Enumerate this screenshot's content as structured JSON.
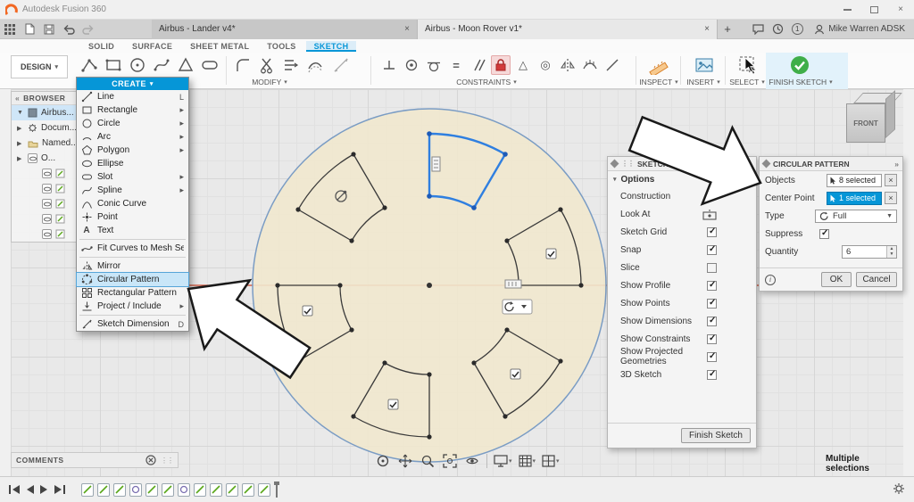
{
  "title_bar": {
    "app_title": "Autodesk Fusion 360"
  },
  "tab_bar": {
    "tabs": [
      {
        "label": "Airbus - Lander v4*"
      },
      {
        "label": "Airbus - Moon Rover v1*"
      }
    ],
    "notification_count": "1",
    "user_name": "Mike Warren ADSK"
  },
  "ribbon": {
    "env_tabs": [
      {
        "label": "SOLID"
      },
      {
        "label": "SURFACE"
      },
      {
        "label": "SHEET METAL"
      },
      {
        "label": "TOOLS"
      },
      {
        "label": "SKETCH"
      }
    ],
    "design_label": "DESIGN",
    "group_labels": {
      "create": "CREATE",
      "modify": "MODIFY",
      "constraints": "CONSTRAINTS",
      "inspect": "INSPECT",
      "insert": "INSERT",
      "select": "SELECT",
      "finish": "FINISH SKETCH"
    }
  },
  "browser": {
    "header": "BROWSER",
    "items": [
      {
        "label": "Airbus..."
      },
      {
        "label": "Docum..."
      },
      {
        "label": "Named..."
      },
      {
        "label": "O..."
      }
    ]
  },
  "create_menu": {
    "header": "CREATE",
    "items": [
      {
        "label": "Line",
        "shortcut": "L"
      },
      {
        "label": "Rectangle"
      },
      {
        "label": "Circle"
      },
      {
        "label": "Arc"
      },
      {
        "label": "Polygon"
      },
      {
        "label": "Ellipse"
      },
      {
        "label": "Slot"
      },
      {
        "label": "Spline"
      },
      {
        "label": "Conic Curve"
      },
      {
        "label": "Point"
      },
      {
        "label": "Text"
      },
      {
        "label": "Fit Curves to Mesh Section"
      },
      {
        "label": "Mirror"
      },
      {
        "label": "Circular Pattern",
        "highlighted": true
      },
      {
        "label": "Rectangular Pattern"
      },
      {
        "label": "Project / Include"
      },
      {
        "label": "Sketch Dimension",
        "shortcut": "D"
      }
    ]
  },
  "sketch_palette": {
    "header": "SKETCH PALETTE",
    "section": "Options",
    "rows": [
      {
        "label": "Construction",
        "type": "icon"
      },
      {
        "label": "Look At",
        "type": "icon"
      },
      {
        "label": "Sketch Grid",
        "type": "checkbox",
        "checked": true
      },
      {
        "label": "Snap",
        "type": "checkbox",
        "checked": true
      },
      {
        "label": "Slice",
        "type": "checkbox",
        "checked": false
      },
      {
        "label": "Show Profile",
        "type": "checkbox",
        "checked": true
      },
      {
        "label": "Show Points",
        "type": "checkbox",
        "checked": true
      },
      {
        "label": "Show Dimensions",
        "type": "checkbox",
        "checked": true
      },
      {
        "label": "Show Constraints",
        "type": "checkbox",
        "checked": true
      },
      {
        "label": "Show Projected Geometries",
        "type": "checkbox",
        "checked": true
      },
      {
        "label": "3D Sketch",
        "type": "checkbox",
        "checked": true
      }
    ],
    "finish_button": "Finish Sketch"
  },
  "circular_pattern": {
    "header": "CIRCULAR PATTERN",
    "objects_label": "Objects",
    "objects_value": "8 selected",
    "center_label": "Center Point",
    "center_value": "1 selected",
    "type_label": "Type",
    "type_value": "Full",
    "suppress_label": "Suppress",
    "suppress_checked": true,
    "quantity_label": "Quantity",
    "quantity_value": "6",
    "ok": "OK",
    "cancel": "Cancel"
  },
  "viewcube": {
    "front_label": "FRONT"
  },
  "status": {
    "selection": "Multiple selections"
  },
  "comments": {
    "label": "COMMENTS"
  },
  "colors": {
    "accent": "#0696d7",
    "finish_green": "#3fae49",
    "axis_red": "#cf4a2e",
    "canvas_fill": "#f1e8d0",
    "selection_blue": "#2f7fe0"
  }
}
